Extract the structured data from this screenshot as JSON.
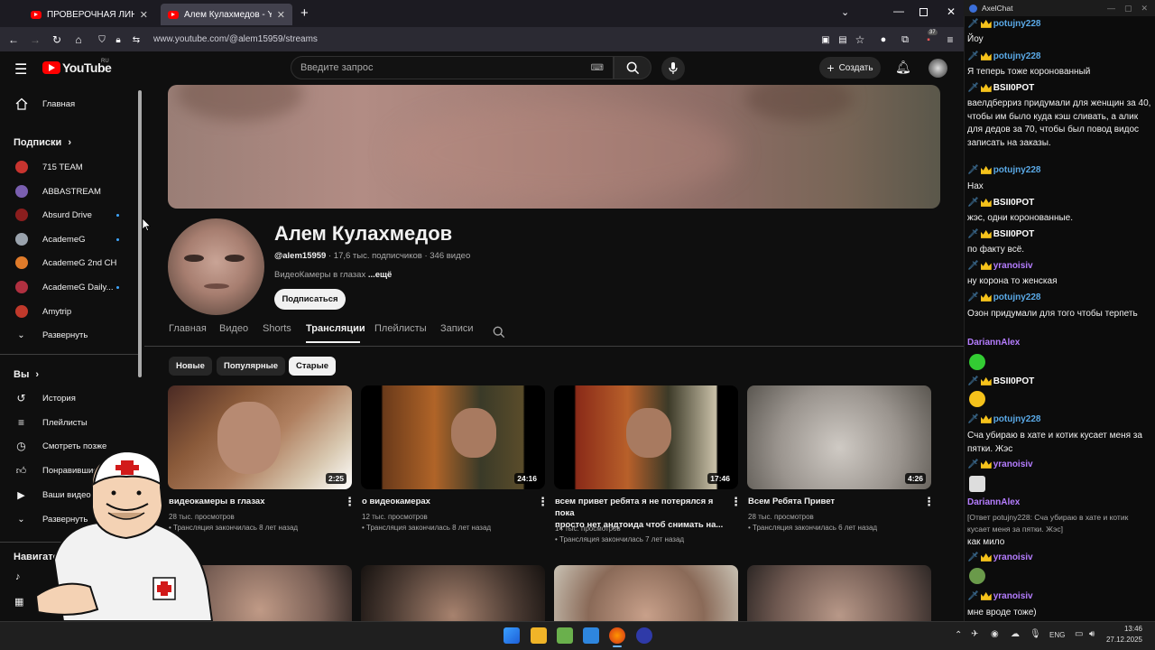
{
  "browser": {
    "tabs": [
      {
        "title": "ПРОВЕРОЧНАЯ ЛИНЕЙКА - М",
        "active": false
      },
      {
        "title": "Алем Кулахмедов - YouTube",
        "active": true
      }
    ],
    "new_tab": "+",
    "url": "www.youtube.com/@alem15959/streams",
    "url_host": "www.youtube.com",
    "url_path": "/@alem15959/streams",
    "extension_badge": "37"
  },
  "youtube": {
    "logo_text": "YouTube",
    "logo_region": "RU",
    "search_placeholder": "Введите запрос",
    "create_label": "Создать"
  },
  "sidebar": {
    "home": "Главная",
    "subs_heading": "Подписки",
    "subscriptions": [
      {
        "name": "715 TEAM",
        "live": false,
        "color": "#c8342f"
      },
      {
        "name": "ABBASTREAM",
        "live": false,
        "color": "#7a5fb0"
      },
      {
        "name": "Absurd Drive",
        "live": true,
        "color": "#8b1e1e"
      },
      {
        "name": "AcademeG",
        "live": true,
        "color": "#9aa3ad"
      },
      {
        "name": "AcademeG 2nd CH",
        "live": false,
        "color": "#e07b2a"
      },
      {
        "name": "AcademeG Daily...",
        "live": true,
        "color": "#b03040"
      },
      {
        "name": "Amytrip",
        "live": false,
        "color": "#c0392b"
      }
    ],
    "expand1": "Развернуть",
    "you_heading": "Вы",
    "you_items": [
      "История",
      "Плейлисты",
      "Смотреть позже",
      "Понравившиеся",
      "Ваши видео"
    ],
    "expand2": "Развернуть",
    "nav_heading": "Навигатор"
  },
  "channel": {
    "name": "Алем Кулахмедов",
    "handle": "@alem15959",
    "stats": " · 17,6 тыс. подписчиков · 346 видео",
    "description": "ВидеоКамеры в глазах",
    "more": "...ещё",
    "subscribe": "Подписаться",
    "tabs": [
      "Главная",
      "Видео",
      "Shorts",
      "Трансляции",
      "Плейлисты",
      "Записи"
    ],
    "active_tab": "Трансляции",
    "chips": [
      "Новые",
      "Популярные",
      "Старые"
    ],
    "active_chip": "Старые"
  },
  "videos": [
    {
      "title": "видеокамеры в глазах",
      "title2": "",
      "views": "28 тыс. просмотров",
      "ago": "Трансляция закончилась 8 лет назад",
      "duration": "2:25"
    },
    {
      "title": "о видеокамерах",
      "title2": "",
      "views": "12 тыс. просмотров",
      "ago": "Трансляция закончилась 8 лет назад",
      "duration": "24:16"
    },
    {
      "title": "всем привет ребята я не потерялся я пока",
      "title2": "просто нет андтоида чтоб снимать на...",
      "views": "14 тыс. просмотров",
      "ago": "Трансляция закончилась 7 лет назад",
      "duration": "17:46"
    },
    {
      "title": "Всем Ребята Привет",
      "title2": "",
      "views": "28 тыс. просмотров",
      "ago": "Трансляция закончилась 6 лет назад",
      "duration": "4:26"
    }
  ],
  "chat": {
    "title": "AxelChat",
    "messages": [
      {
        "user": "potujny228",
        "color": "#5aa9e6",
        "crown": true,
        "text": "Йоу"
      },
      {
        "user": "potujny228",
        "color": "#5aa9e6",
        "crown": true,
        "text": "Я теперь тоже коронованный"
      },
      {
        "user": "BSII0POT",
        "color": "#ffffff",
        "crown": true,
        "text": "ваелдберриз придумали для женщин за 40, чтобы им было куда кэш сливать, а алик для дедов за 70, чтобы был повод видос записать на заказы."
      },
      {
        "user": "potujny228",
        "color": "#5aa9e6",
        "crown": true,
        "text": "Нах"
      },
      {
        "user": "BSII0POT",
        "color": "#ffffff",
        "crown": true,
        "text": "жэс, одни коронованные."
      },
      {
        "user": "BSII0POT",
        "color": "#ffffff",
        "crown": true,
        "text": "по факту всё."
      },
      {
        "user": "yranoisiv",
        "color": "#b57dff",
        "crown": true,
        "text": "ну корона то женская"
      },
      {
        "user": "potujny228",
        "color": "#5aa9e6",
        "crown": true,
        "text": "Озон придумали для того чтобы терпеть"
      },
      {
        "user": "DariannAlex",
        "color": "#b57dff",
        "crown": false,
        "text": ""
      },
      {
        "user": "BSII0POT",
        "color": "#ffffff",
        "crown": true,
        "text": ""
      },
      {
        "user": "potujny228",
        "color": "#5aa9e6",
        "crown": true,
        "text": "Сча убираю в хате и котик кусает меня за пятки. Жэс"
      },
      {
        "user": "yranoisiv",
        "color": "#b57dff",
        "crown": true,
        "text": ""
      },
      {
        "user": "DariannAlex",
        "color": "#b57dff",
        "crown": false,
        "reply": "[Ответ potujny228: Сча убираю в хате и котик кусает меня за пятки. Жэс]",
        "text": "как мило"
      },
      {
        "user": "yranoisiv",
        "color": "#b57dff",
        "crown": true,
        "text": ""
      },
      {
        "user": "yranoisiv",
        "color": "#b57dff",
        "crown": true,
        "text": "мне вроде тоже)"
      }
    ]
  },
  "taskbar": {
    "lang": "ENG",
    "time": "13:46",
    "date": "27.12.2025"
  }
}
